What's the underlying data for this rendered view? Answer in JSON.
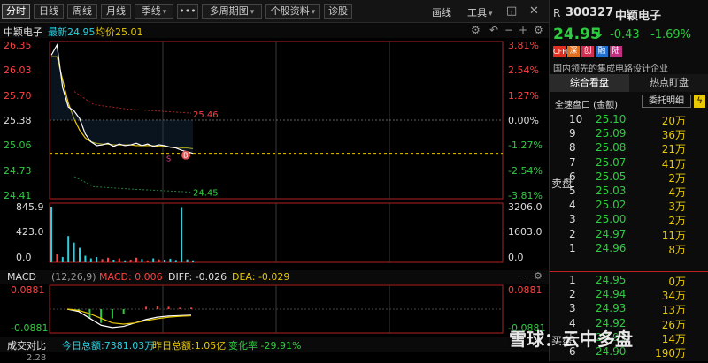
{
  "toolbar": {
    "tabs": [
      "分时",
      "日线",
      "周线",
      "月线",
      "季线"
    ],
    "more": "•••",
    "multi_period": "多周期图",
    "stock_info": "个股资料",
    "diagnose": "诊股",
    "draw_line": "画线",
    "tools": "工具"
  },
  "info": {
    "name": "中颖电子",
    "latest_label": "最新24.95",
    "avg_label": "均价25.01"
  },
  "price_axis_left": [
    "26.35",
    "26.03",
    "25.70",
    "25.38",
    "25.06",
    "24.73",
    "24.41"
  ],
  "pct_axis_right": [
    "3.81%",
    "2.54%",
    "1.27%",
    "0.00%",
    "-1.27%",
    "-2.54%",
    "-3.81%"
  ],
  "volume_axis_left": [
    "845.9",
    "423.0",
    "0.0"
  ],
  "volume_axis_right": [
    "3206.0",
    "1603.0",
    "0.0"
  ],
  "annotations": {
    "high_marker": "26.35",
    "low_marker": "24.45",
    "mid_marker": "25.46",
    "buy_sell_markers": [
      "B",
      "S"
    ]
  },
  "macd": {
    "title": "MACD",
    "params": "(12,26,9)",
    "macd": "MACD: 0.006",
    "diff": "DIFF: -0.026",
    "dea": "DEA: -0.029",
    "axis_left": [
      "0.0881",
      "-0.0881"
    ],
    "axis_right": [
      "0.0881",
      "-0.0881"
    ]
  },
  "bottom": {
    "title": "成交对比",
    "today_total": "今日总额:7381.03万",
    "yesterday_total": "昨日总额:1.05亿",
    "change": "变化率 -29.91%",
    "axis_left": "2.28"
  },
  "quote": {
    "flag": "R",
    "code": "300327",
    "name": "中颖电子",
    "price": "24.95",
    "change": "-0.43",
    "change_pct": "-1.69%",
    "badges": [
      "CFH",
      "深",
      "创",
      "融",
      "陆"
    ],
    "description": "国内领先的集成电路设计企业",
    "tabs": [
      "综合看盘",
      "热点盯盘"
    ],
    "quick_panel": "全速盘口 (金额)",
    "order_detail": "委托明细",
    "sell_label": "卖盘",
    "buy_label": "买盘"
  },
  "order_book_sell": [
    {
      "level": "10",
      "price": "25.10",
      "vol": "20万"
    },
    {
      "level": "9",
      "price": "25.09",
      "vol": "36万"
    },
    {
      "level": "8",
      "price": "25.08",
      "vol": "21万"
    },
    {
      "level": "7",
      "price": "25.07",
      "vol": "41万"
    },
    {
      "level": "6",
      "price": "25.05",
      "vol": "2万"
    },
    {
      "level": "5",
      "price": "25.03",
      "vol": "4万"
    },
    {
      "level": "4",
      "price": "25.02",
      "vol": "3万"
    },
    {
      "level": "3",
      "price": "25.00",
      "vol": "2万"
    },
    {
      "level": "2",
      "price": "24.97",
      "vol": "11万"
    },
    {
      "level": "1",
      "price": "24.96",
      "vol": "8万"
    }
  ],
  "order_book_buy": [
    {
      "level": "1",
      "price": "24.95",
      "vol": "0万"
    },
    {
      "level": "2",
      "price": "24.94",
      "vol": "34万"
    },
    {
      "level": "3",
      "price": "24.93",
      "vol": "13万"
    },
    {
      "level": "4",
      "price": "24.92",
      "vol": "26万"
    },
    {
      "level": "5",
      "price": "24.91",
      "vol": "14万"
    },
    {
      "level": "6",
      "price": "24.90",
      "vol": "190万"
    }
  ],
  "watermark": "雪球：云中多盘",
  "colors": {
    "up": "#ff4040",
    "down": "#2ecc40",
    "price_line": "#4aa8ff",
    "avg_line": "#e8c800",
    "background": "#000000"
  },
  "chart_data": {
    "type": "line",
    "title": "",
    "price_series": [
      26.22,
      26.35,
      25.8,
      25.55,
      25.5,
      25.4,
      25.2,
      25.1,
      25.05,
      25.06,
      25.08,
      25.04,
      25.07,
      25.05,
      25.06,
      25.08,
      25.05,
      25.07,
      25.04,
      25.06,
      25.05,
      25.03,
      25.02,
      24.99,
      24.97,
      24.95
    ],
    "avg_series": [
      26.2,
      26.2,
      25.9,
      25.6,
      25.4,
      25.25,
      25.15,
      25.1,
      25.08,
      25.07,
      25.07,
      25.06,
      25.06,
      25.06,
      25.06,
      25.05,
      25.05,
      25.05,
      25.05,
      25.04,
      25.04,
      25.03,
      25.03,
      25.02,
      25.02,
      25.01
    ],
    "ylim": [
      24.41,
      26.35
    ],
    "prev_close": 25.38,
    "volume_values": [
      845.9,
      120,
      80,
      400,
      300,
      220,
      100,
      60,
      80,
      50,
      70,
      40,
      60,
      30,
      40,
      70,
      50,
      30,
      60,
      45,
      40,
      55,
      35,
      840,
      45,
      30
    ],
    "volume_ylim": [
      0,
      845.9
    ],
    "macd_diff": [
      0.0,
      -0.01,
      -0.04,
      -0.07,
      -0.08,
      -0.075,
      -0.06,
      -0.045,
      -0.035,
      -0.03,
      -0.028,
      -0.026
    ],
    "macd_dea": [
      0.0,
      -0.005,
      -0.02,
      -0.04,
      -0.06,
      -0.065,
      -0.06,
      -0.05,
      -0.042,
      -0.035,
      -0.031,
      -0.029
    ],
    "macd_ylim": [
      -0.0881,
      0.0881
    ]
  }
}
